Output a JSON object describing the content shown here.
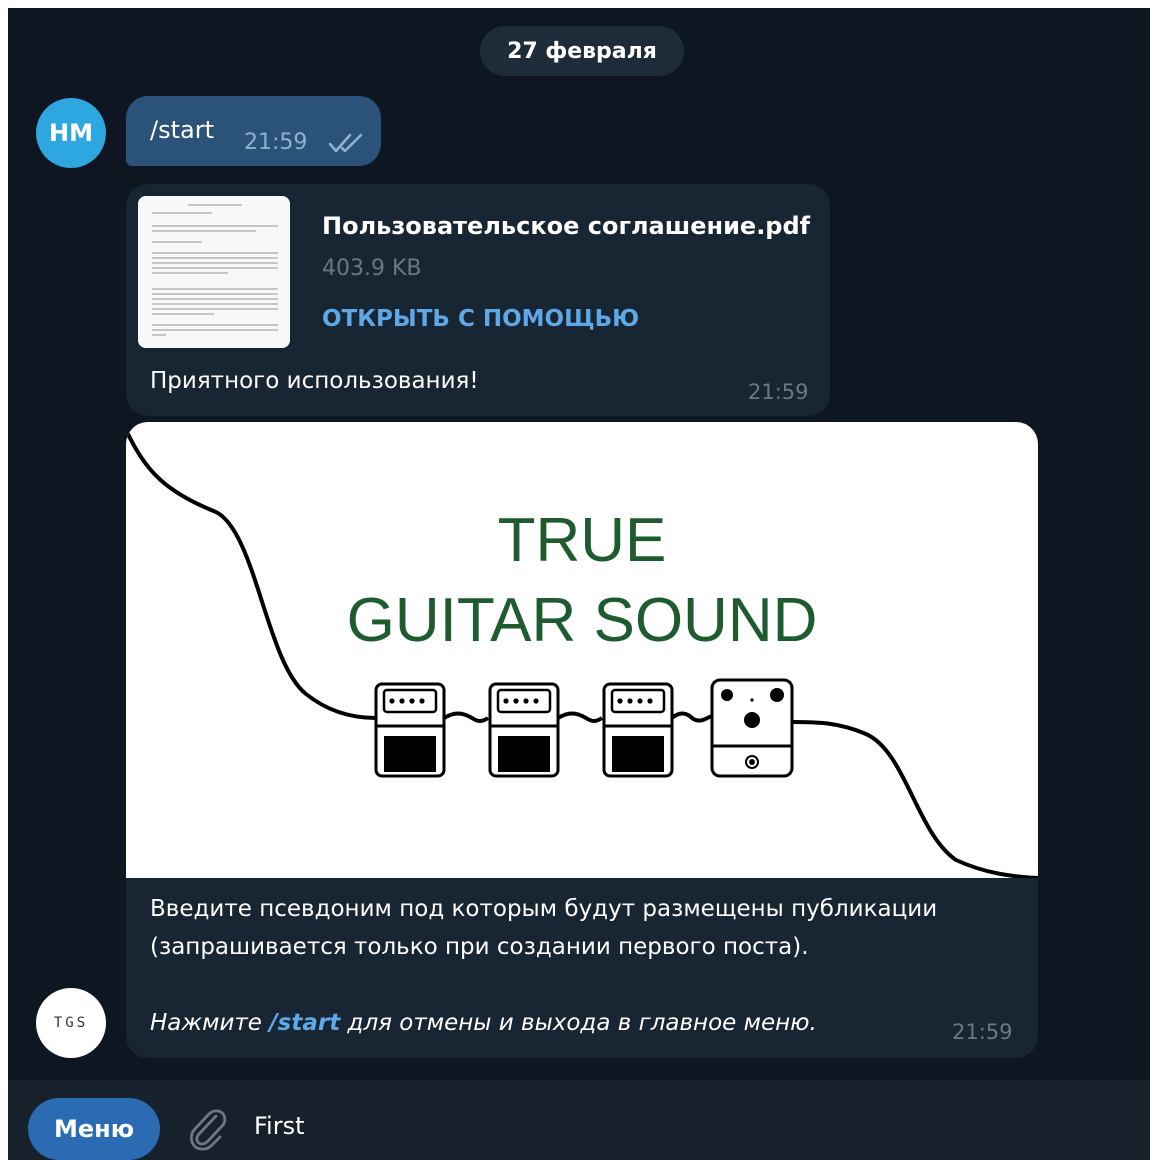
{
  "chat": {
    "date_label": "27 февраля",
    "user_avatar": "НМ",
    "bot_avatar": "TGS",
    "out_message": {
      "text": "/start",
      "time": "21:59",
      "status_icon": "double-check-icon"
    },
    "document": {
      "file_name": "Пользовательское соглашение.pdf",
      "file_size": "403.9 KB",
      "open_with_label": "ОТКРЫТЬ С ПОМОЩЬЮ",
      "caption": "Приятного использования!",
      "time": "21:59"
    },
    "image_message": {
      "image_title_line1": "TRUE",
      "image_title_line2": "GUITAR SOUND",
      "text_line1": "Введите псевдоним под которым будут размещены публикации",
      "text_line2": "(запрашивается только при создании первого поста).",
      "text_italic_prefix": "Нажмите ",
      "text_italic_command": "/start",
      "text_italic_suffix": " для отмены и выхода в главное меню.",
      "time": "21:59"
    }
  },
  "composer": {
    "menu_label": "Меню",
    "attach_icon": "paperclip-icon",
    "input_value": "First"
  },
  "colors": {
    "background": "#0e1621",
    "outgoing_bubble": "#2b5278",
    "incoming_bubble": "#182533",
    "accent": "#5fa8e8",
    "logo_green": "#1e5b2e"
  }
}
